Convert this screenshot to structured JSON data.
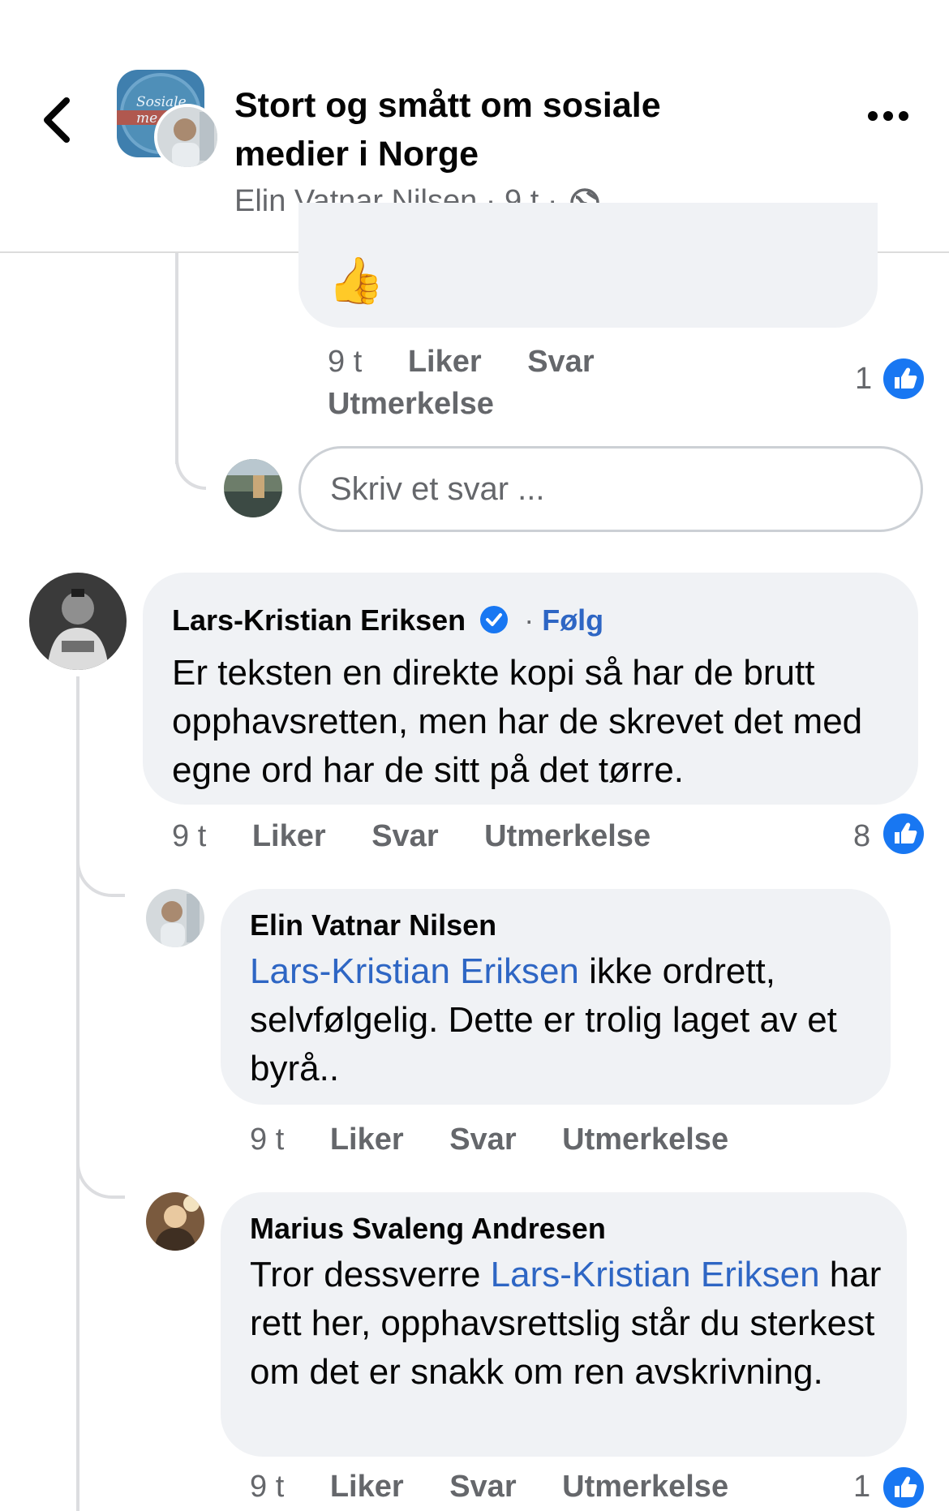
{
  "header": {
    "group_title": "Stort og smått om sosiale medier i Norge",
    "author": "Elin Vatnar Nilsen",
    "time": "9 t",
    "separator": "·",
    "group_badge_text": "Sosiale me"
  },
  "prev_comment": {
    "emoji": "👍",
    "time": "9 t",
    "like": "Liker",
    "reply": "Svar",
    "award": "Utmerkelse",
    "likes": "1"
  },
  "reply_box": {
    "placeholder": "Skriv et svar ..."
  },
  "comments": [
    {
      "author": "Lars-Kristian Eriksen",
      "verified": true,
      "follow": "Følg",
      "text": "Er teksten en direkte kopi så har de brutt opphavsretten, men har de skrevet det med egne ord har de sitt på det tørre.",
      "time": "9 t",
      "like": "Liker",
      "reply": "Svar",
      "award": "Utmerkelse",
      "likes": "8"
    },
    {
      "author": "Elin Vatnar Nilsen",
      "mention": "Lars-Kristian Eriksen",
      "text": " ikke ordrett, selvfølgelig. Dette er trolig laget av et byrå..",
      "time": "9 t",
      "like": "Liker",
      "reply": "Svar",
      "award": "Utmerkelse"
    },
    {
      "author": "Marius Svaleng Andresen",
      "text_before": "Tror dessverre ",
      "mention": "Lars-Kristian Eriksen",
      "text_after": " har rett her, opphavsrettslig står du sterkest om det er snakk om ren avskrivning.",
      "time": "9 t",
      "like": "Liker",
      "reply": "Svar",
      "award": "Utmerkelse",
      "likes": "1"
    }
  ],
  "colors": {
    "accent": "#1877f2",
    "mention": "#2e66c4",
    "bubble": "#f0f2f5",
    "muted": "#65676b"
  }
}
